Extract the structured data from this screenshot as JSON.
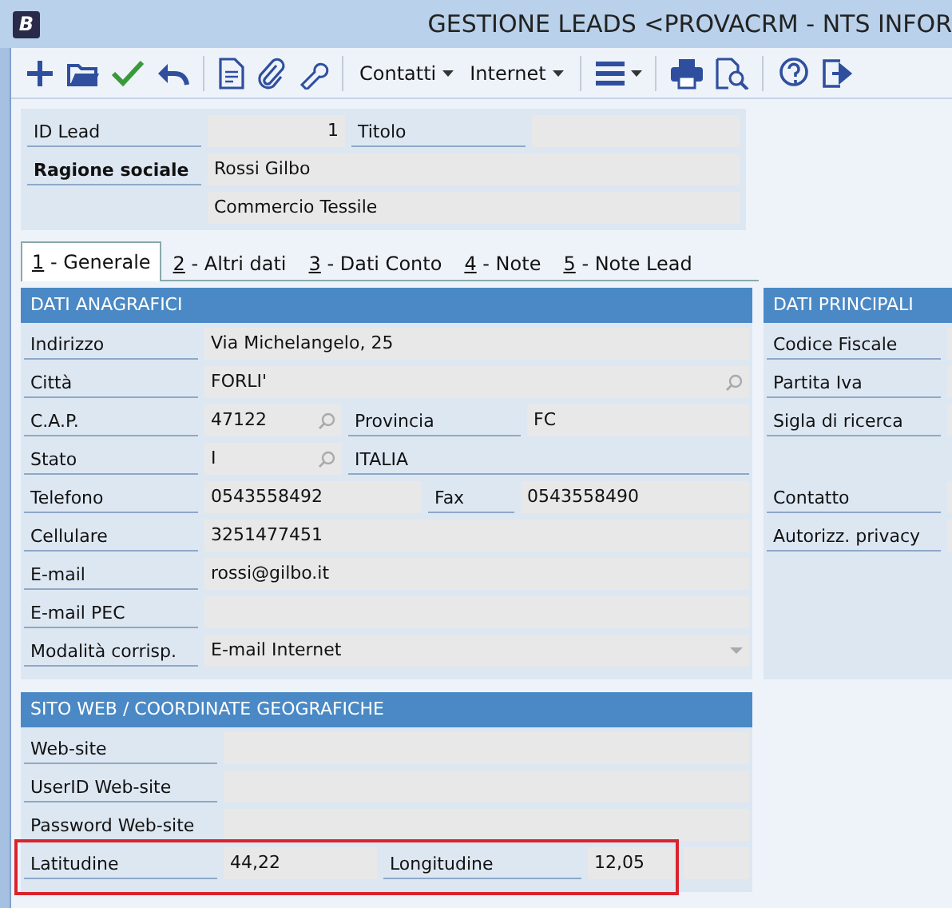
{
  "window": {
    "logo": "B",
    "title": "GESTIONE LEADS <PROVACRM - NTS INFOR"
  },
  "toolbar": {
    "menus": [
      {
        "label": "Contatti"
      },
      {
        "label": "Internet"
      }
    ]
  },
  "header": {
    "rows": [
      {
        "kind": "number_pair",
        "label": "ID Lead",
        "value": "1",
        "label2": "Titolo"
      },
      {
        "kind": "bold_text",
        "label": "Ragione sociale",
        "value": "Rossi Gilbo"
      },
      {
        "kind": "continuation",
        "value": "Commercio Tessile"
      }
    ]
  },
  "tabs": [
    {
      "key": "1",
      "label": "- Generale",
      "selected": true
    },
    {
      "key": "2",
      "label": "- Altri dati",
      "selected": false
    },
    {
      "key": "3",
      "label": "- Dati Conto",
      "selected": false
    },
    {
      "key": "4",
      "label": "- Note",
      "selected": false
    },
    {
      "key": "5",
      "label": "- Note Lead",
      "selected": false
    }
  ],
  "dati_anagrafici": {
    "title": "DATI ANAGRAFICI",
    "rows": [
      {
        "kind": "text",
        "label": "Indirizzo",
        "value": "Via Michelangelo, 25"
      },
      {
        "kind": "lookup",
        "label": "Città",
        "value": "FORLI'"
      },
      {
        "kind": "lookup_pair",
        "label": "C.A.P.",
        "value": "47122",
        "label2": "Provincia",
        "value2": "FC"
      },
      {
        "kind": "lookup_desc",
        "label": "Stato",
        "value": "I",
        "description": "ITALIA"
      },
      {
        "kind": "pair",
        "label": "Telefono",
        "value": "0543558492",
        "label2": "Fax",
        "value2": "0543558490"
      },
      {
        "kind": "text",
        "label": "Cellulare",
        "value": "3251477451"
      },
      {
        "kind": "text",
        "label": "E-mail",
        "value": "rossi@gilbo.it"
      },
      {
        "kind": "text",
        "label": "E-mail PEC"
      },
      {
        "kind": "select",
        "label": "Modalità corrisp.",
        "value": "E-mail Internet"
      }
    ]
  },
  "dati_principali": {
    "title": "DATI PRINCIPALI",
    "rows": [
      {
        "kind": "text",
        "label": "Codice Fiscale"
      },
      {
        "kind": "text",
        "label": "Partita Iva"
      },
      {
        "kind": "text",
        "label": "Sigla di ricerca"
      },
      {
        "kind": "blank"
      },
      {
        "kind": "text",
        "label": "Contatto"
      },
      {
        "kind": "text",
        "label": "Autorizz. privacy"
      }
    ]
  },
  "sito_web": {
    "title": "SITO WEB / COORDINATE GEOGRAFICHE",
    "rows": [
      {
        "kind": "text",
        "label": "Web-site",
        "highlighted": false
      },
      {
        "kind": "text",
        "label": "UserID Web-site",
        "highlighted": false
      },
      {
        "kind": "text",
        "label": "Password Web-site",
        "highlighted": false
      },
      {
        "kind": "pair",
        "label": "Latitudine",
        "value": "44,22",
        "label2": "Longitudine",
        "value2": "12,05",
        "highlighted": true
      }
    ]
  }
}
